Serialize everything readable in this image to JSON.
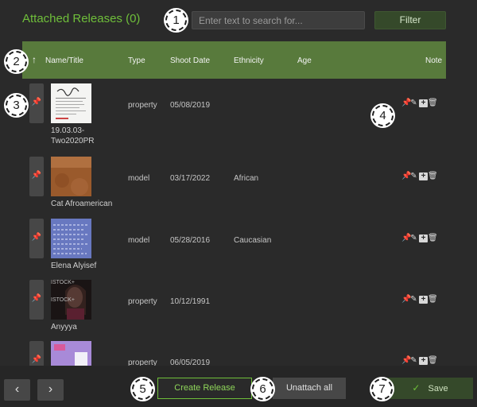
{
  "title": "Attached Releases (0)",
  "search": {
    "placeholder": "Enter text to search for..."
  },
  "filter_label": "Filter",
  "columns": {
    "sort_icon": "↑",
    "name": "Name/Title",
    "type": "Type",
    "shoot_date": "Shoot Date",
    "ethnicity": "Ethnicity",
    "age": "Age",
    "note": "Note"
  },
  "rows": [
    {
      "name": "19.03.03-Two2020PR",
      "type": "property",
      "shoot_date": "05/08/2019",
      "ethnicity": "",
      "age": "",
      "thumb": "document"
    },
    {
      "name": "Cat Afroamerican",
      "type": "model",
      "shoot_date": "03/17/2022",
      "ethnicity": "African",
      "age": "",
      "thumb": "brown-texture"
    },
    {
      "name": "Elena Alyisef",
      "type": "model",
      "shoot_date": "05/28/2016",
      "ethnicity": "Caucasian",
      "age": "",
      "thumb": "handwritten-form"
    },
    {
      "name": "Anyyya",
      "type": "property",
      "shoot_date": "10/12/1991",
      "ethnicity": "",
      "age": "",
      "thumb": "portrait-watermark"
    },
    {
      "name": "",
      "type": "property",
      "shoot_date": "06/05/2019",
      "ethnicity": "",
      "age": "",
      "thumb": "purple-card"
    }
  ],
  "thumb_watermark": "ISTOCK+",
  "footer": {
    "prev_icon": "‹",
    "next_icon": "›",
    "create_label": "Create Release",
    "unattach_label": "Unattach all",
    "save_icon": "✓",
    "save_label": "Save"
  },
  "markers": [
    "1",
    "2",
    "3",
    "4",
    "5",
    "6",
    "7"
  ],
  "colors": {
    "accent_green": "#6fbf3a",
    "header_green": "#587a3c",
    "background": "#2a2a2a",
    "button_gray": "#474747",
    "save_green": "#35492a"
  }
}
